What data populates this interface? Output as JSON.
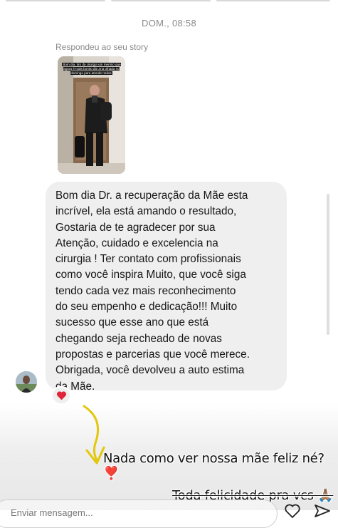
{
  "thread": {
    "timestamp": "DOM., 08:58",
    "reply_context": "Respondeu ao seu story",
    "story_caption": "Bom dia, tiro da cirurgia um menino que agora é mais bonito dá uma olhada no domingo para atender todos"
  },
  "message": {
    "text": "Bom dia Dr. a recuperação da Mãe esta\nincrível, ela está amando o resultado,\nGostaria de te agradecer por sua\nAtenção, cuidado e excelencia na\ncirurgia ! Ter contato com profissionais\ncomo você inspira Muito, que você siga\ntendo cada vez mais reconhecimento\ndo seu empenho e dedicação!!! Muito\nsucesso que esse ano que está\nchegando seja recheado de novas\npropostas e parcerias que você merece.\nObrigada, você devolveu a auto estima\nda Mãe.",
    "reaction": "❤️"
  },
  "overlay": {
    "line1": "Nada como ver nossa mãe feliz né? ❣️",
    "line2": "Toda felicidade pra vcs 🙏🏽"
  },
  "composer": {
    "placeholder": "Enviar mensagem..."
  },
  "colors": {
    "bubble": "#efefef",
    "heart": "#e0243a",
    "arrow": "#e3c70a"
  },
  "icons": [
    "heart-icon",
    "send-icon",
    "curved-arrow-icon"
  ]
}
